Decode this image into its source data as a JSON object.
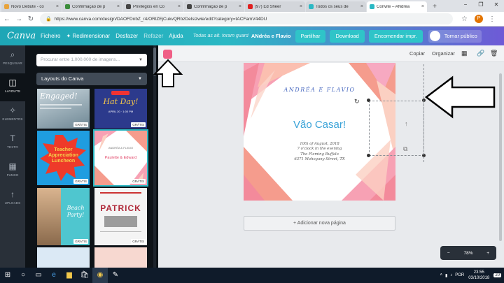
{
  "browser": {
    "tabs": [
      {
        "title": "Novo Debute - co",
        "favicon_color": "#e8a33c",
        "active": false
      },
      {
        "title": "Confirmação de p",
        "favicon_color": "#3c8d3c",
        "active": false
      },
      {
        "title": "Privilegios en Co",
        "favicon_color": "#444444",
        "active": false
      },
      {
        "title": "Confirmação de p",
        "favicon_color": "#444444",
        "active": false
      },
      {
        "title": "(97) Ed Sheer",
        "favicon_color": "#e02020",
        "active": false
      },
      {
        "title": "Todos os seus de",
        "favicon_color": "#2bb8c4",
        "active": false
      },
      {
        "title": "Convite – ANdréa",
        "favicon_color": "#2bb8c4",
        "active": true
      }
    ],
    "new_tab_icon": "plus-icon",
    "window_controls": [
      "−",
      "❐",
      "✕"
    ],
    "url": "https://www.canva.com/design/DAOFDnbZ_r4/ORlZEjCukvQRbzDelsizwie/edit?category=tACFamV44DU",
    "profile_initial": "P"
  },
  "canva_header": {
    "logo": "Canva",
    "menu": [
      "Ficheiro",
      "Redimensionar",
      "Desfazer",
      "Refazer",
      "Ajuda"
    ],
    "saved_status": "Todas as alt. foram guard",
    "doc_title": "ANdréa e Flavio",
    "buttons": {
      "share": "Partilhar",
      "download": "Download",
      "order": "Encomendar impr.",
      "publish": "Tornar público"
    }
  },
  "rail": [
    {
      "label": "PESQUISAR",
      "icon": "search-icon",
      "glyph": "⌕",
      "active": false
    },
    {
      "label": "LAYOUTS",
      "icon": "layout-icon",
      "glyph": "◫",
      "active": true
    },
    {
      "label": "ELEMENTOS",
      "icon": "shapes-icon",
      "glyph": "✧",
      "active": false
    },
    {
      "label": "TEXTO",
      "icon": "text-icon",
      "glyph": "T",
      "active": false
    },
    {
      "label": "FUNDO",
      "icon": "background-icon",
      "glyph": "▦",
      "active": false
    },
    {
      "label": "UPLOADS",
      "icon": "upload-icon",
      "glyph": "↑",
      "active": false
    }
  ],
  "panel": {
    "search_placeholder": "Procurar entre 1.000.000 de imagens...",
    "layout_select": "Layouts do Canva",
    "thumbs": [
      {
        "lines": [
          "Engaged!"
        ],
        "badge": "GRÁTIS"
      },
      {
        "lines": [
          "Hat Day!",
          "APRIL 20 · 1:00 PM"
        ],
        "badge": "GRÁTIS"
      },
      {
        "lines": [
          "Teacher",
          "Appreciation",
          "Luncheon"
        ],
        "badge": "GRÁTIS"
      },
      {
        "lines": [
          "ANDRÉA & FLAVIO",
          "Paulette & Edward"
        ],
        "badge": "GRÁTIS"
      },
      {
        "lines": [
          "Beach",
          "Party!"
        ],
        "badge": "GRÁTIS"
      },
      {
        "lines": [
          "PATRICK"
        ],
        "badge": "GRÁTIS"
      }
    ]
  },
  "workspace_toolbar": {
    "copy": "Copiar",
    "arrange": "Organizar"
  },
  "design": {
    "names": "ANDRÉA E FLAVIO",
    "headline": "Vão Casar!",
    "details": [
      "10th of August, 2018",
      "7 o'clock in the evening",
      "The Fleming Buffalo",
      "6371 Mahogany Street, TX"
    ],
    "accent_color": "#f05f86",
    "headline_color": "#3aa3d8",
    "names_color": "#4a6ac0"
  },
  "add_page": "+ Adicionar nova página",
  "zoom": {
    "level": "78%"
  },
  "taskbar": {
    "lang": "POR",
    "time": "23:55",
    "date": "03/10/2018",
    "notifications": "20"
  }
}
